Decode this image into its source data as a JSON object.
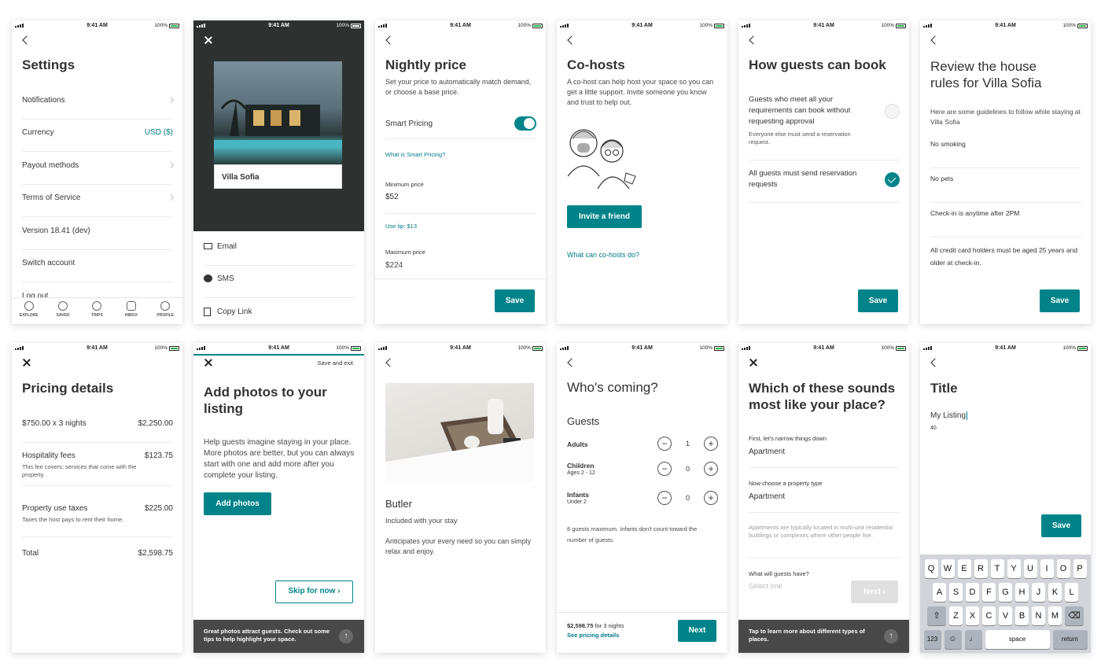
{
  "status": {
    "time": "9:41 AM",
    "battery": "100%"
  },
  "settings": {
    "title": "Settings",
    "items": [
      "Notifications",
      "Currency",
      "Payout methods",
      "Terms of Service",
      "Version 18.41 (dev)",
      "Switch account",
      "Log out"
    ],
    "currency_value": "USD ($)",
    "tabs": [
      "EXPLORE",
      "SAVED",
      "TRIPS",
      "INBOX",
      "PROFILE"
    ]
  },
  "share": {
    "listing": "Villa Sofia",
    "options": [
      "Email",
      "SMS",
      "Copy Link"
    ]
  },
  "nightly": {
    "title": "Nightly price",
    "desc": "Set your price to automatically match demand, or choose a base price.",
    "smart": "Smart Pricing",
    "what": "What is Smart Pricing?",
    "min_label": "Minimum price",
    "min_value": "$52",
    "tip": "Use tip: $13",
    "max_label": "Maximum price",
    "max_value": "$224",
    "save": "Save"
  },
  "cohosts": {
    "title": "Co-hosts",
    "desc": "A co-host can help host your space so you can get a little support. Invite someone you know and trust to help out.",
    "invite": "Invite a friend",
    "link": "What can co-hosts do?"
  },
  "booking": {
    "title": "How guests can book",
    "opt1": "Guests who meet all your requirements can book without requesting approval",
    "opt1_sub": "Everyone else must send a reservation request.",
    "opt2": "All guests must send reservation requests",
    "save": "Save"
  },
  "rules": {
    "title": "Review the house rules for Villa Sofia",
    "intro": "Here are some guidelines to follow while staying at Villa Sofia",
    "items": [
      "No smoking",
      "No pets",
      "Check-in is anytime after 2PM",
      "All credit card holders must be aged 25 years and older at check-in."
    ],
    "save": "Save"
  },
  "pricing": {
    "title": "Pricing details",
    "lines": [
      {
        "label": "$750.00 x 3 nights",
        "value": "$2,250.00",
        "note": ""
      },
      {
        "label": "Hospitality fees",
        "value": "$123.75",
        "note": "This fee covers: services that come with the property."
      },
      {
        "label": "Property use taxes",
        "value": "$225.00",
        "note": "Taxes the host pays to rent their home."
      },
      {
        "label": "Total",
        "value": "$2,598.75",
        "note": ""
      }
    ]
  },
  "photos": {
    "save_exit": "Save and exit",
    "title": "Add photos to your listing",
    "desc": "Help guests imagine staying in your place. More photos are better, but you can always start with one and add more after you complete your listing.",
    "add": "Add photos",
    "skip": "Skip for now",
    "footer": "Great photos attract guests. Check out some tips to help highlight your space."
  },
  "butler": {
    "title": "Butler",
    "sub": "Included with your stay",
    "desc": "Anticipates your every need so you can simply relax and enjoy."
  },
  "coming": {
    "title": "Who's coming?",
    "guests": "Guests",
    "rows": [
      {
        "label": "Adults",
        "sub": "",
        "count": "1"
      },
      {
        "label": "Children",
        "sub": "Ages 2 - 12",
        "count": "0"
      },
      {
        "label": "Infants",
        "sub": "Under 2",
        "count": "0"
      }
    ],
    "note": "8 guests maximum. Infants don't count toward the number of guests.",
    "total": "$2,598.75",
    "nights": "for 3 nights",
    "details": "See pricing details",
    "next": "Next"
  },
  "place": {
    "title": "Which of these sounds most like your place?",
    "q1": "First, let's narrow things down",
    "a1": "Apartment",
    "q2": "Now choose a property type",
    "a2": "Apartment",
    "hint": "Apartments are typically located in multi-unit residential buildings or complexes where other people live.",
    "q3": "What will guests have?",
    "a3": "Select one",
    "next": "Next",
    "footer": "Tap to learn more about different types of places."
  },
  "titlescreen": {
    "title": "Title",
    "value": "My Listing",
    "count": "40",
    "save": "Save",
    "kb_row1": [
      "Q",
      "W",
      "E",
      "R",
      "T",
      "Y",
      "U",
      "I",
      "O",
      "P"
    ],
    "kb_row2": [
      "A",
      "S",
      "D",
      "F",
      "G",
      "H",
      "J",
      "K",
      "L"
    ],
    "kb_row3": [
      "Z",
      "X",
      "C",
      "V",
      "B",
      "N",
      "M"
    ],
    "kb_num": "123",
    "kb_space": "space",
    "kb_return": "return"
  },
  "colors": {
    "teal": "#008489",
    "dark": "#484848"
  }
}
